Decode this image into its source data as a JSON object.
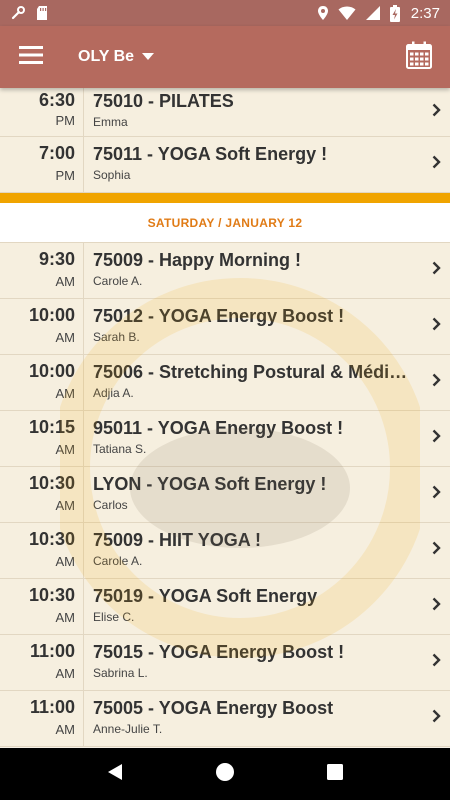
{
  "status_bar": {
    "time": "2:37"
  },
  "app_bar": {
    "studio": "OLY Be"
  },
  "top_classes": [
    {
      "time": "6:30",
      "ampm": "PM",
      "title": "75010 - PILATES",
      "teacher": "Emma"
    },
    {
      "time": "7:00",
      "ampm": "PM",
      "title": "75011 - YOGA Soft Energy !",
      "teacher": "Sophia"
    }
  ],
  "day_header": "SATURDAY / JANUARY 12",
  "classes": [
    {
      "time": "9:30",
      "ampm": "AM",
      "title": "75009 - Happy Morning !",
      "teacher": "Carole A."
    },
    {
      "time": "10:00",
      "ampm": "AM",
      "title": "75012 - YOGA Energy Boost !",
      "teacher": "Sarah B."
    },
    {
      "time": "10:00",
      "ampm": "AM",
      "title": "75006 - Stretching Postural & Médi…",
      "teacher": "Adjia A."
    },
    {
      "time": "10:15",
      "ampm": "AM",
      "title": "95011 - YOGA Energy Boost !",
      "teacher": "Tatiana S."
    },
    {
      "time": "10:30",
      "ampm": "AM",
      "title": "LYON - YOGA Soft Energy !",
      "teacher": "Carlos"
    },
    {
      "time": "10:30",
      "ampm": "AM",
      "title": "75009 - HIIT YOGA !",
      "teacher": "Carole A."
    },
    {
      "time": "10:30",
      "ampm": "AM",
      "title": "75019 - YOGA Soft Energy",
      "teacher": "Elise C."
    },
    {
      "time": "11:00",
      "ampm": "AM",
      "title": "75015 - YOGA Energy Boost !",
      "teacher": "Sabrina L."
    },
    {
      "time": "11:00",
      "ampm": "AM",
      "title": "75005 - YOGA Energy Boost",
      "teacher": "Anne-Julie T."
    }
  ],
  "colors": {
    "status_bar": "#a86860",
    "app_bar": "#b56a5e",
    "row_bg": "#f6efdf",
    "day_header_text": "#e07b16",
    "divider": "#f0a400"
  },
  "icons": {
    "status_left": [
      "wrench-icon",
      "sd-card-icon"
    ],
    "status_right": [
      "location-icon",
      "wifi-icon",
      "signal-icon",
      "battery-charging-icon"
    ],
    "app_bar": [
      "menu-icon",
      "dropdown-arrow-icon",
      "calendar-icon"
    ],
    "row": "chevron-right-icon",
    "nav": [
      "back-icon",
      "home-icon",
      "recents-icon"
    ]
  }
}
